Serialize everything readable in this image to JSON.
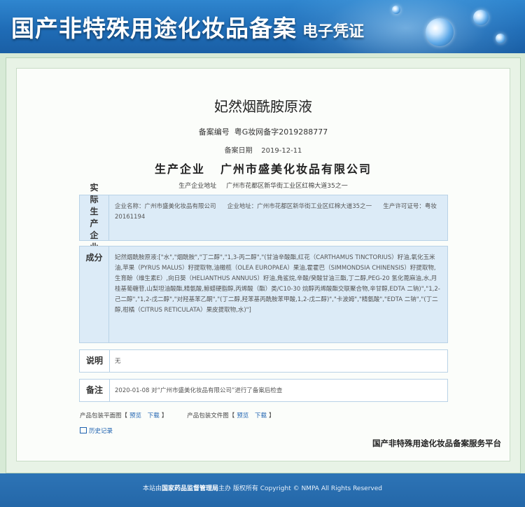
{
  "banner": {
    "title": "国产非特殊用途化妆品备案",
    "subtitle": "电子凭证"
  },
  "product": {
    "name": "妃然烟酰胺原液",
    "record_no_label": "备案编号",
    "record_no": "粤G妆网备字2019288777",
    "record_date_label": "备案日期",
    "record_date": "2019-12-11"
  },
  "producer": {
    "label": "生产企业",
    "name": "广州市盛美化妆品有限公司",
    "address_label": "生产企业地址",
    "address": "广州市花都区新华街工业区红棉大道35之一"
  },
  "sections": {
    "enterprise": {
      "label": "实际生产企业",
      "name_label": "企业名称：",
      "name": "广州市盛美化妆品有限公司",
      "address_label": "企业地址：",
      "address": "广州市花都区新华街工业区红棉大道35之一",
      "license_label": "生产许可证号：",
      "license": "粤妆20161194"
    },
    "ingredients": {
      "label": "成分",
      "text": "妃然烟酰胺原液:[\"水\",\"烟酰胺\",\"丁二醇\",\"1,3-丙二醇\",\"(甘油辛酸酯,红花（CARTHAMUS TINCTORIUS）籽油,氧化玉米油,苹果（PYRUS MALUS）籽提取物,油橄榄（OLEA EUROPAEA）果油,霍霍巴（SIMMONDSIA CHINENSIS）籽提取物,生育酚（维生素E）,向日葵（HELIANTHUS ANNUUS）籽油,角鲨烷,辛酸/癸酸甘油三酯,丁二醇,PEG-20 氢化蓖麻油,水,月桂基葡糖苷,山梨坦油酸酯,精氨酸,鲸蜡硬脂醇,丙烯酸（酯）类/C10-30 烷醇丙烯酸酯交联聚合物,辛甘醇,EDTA 二钠)\",\"1,2-己二醇\",\"1,2-戊二醇\",\"对羟基苯乙酮\",\"(丁二醇,羟苯基丙酰胺苯甲酸,1,2-戊二醇)\",\"卡波姆\",\"精氨酸\",\"EDTA 二钠\",\"(丁二醇,柑橘（CITRUS RETICULATA）果皮提取物,水)\"]"
    },
    "note": {
      "label": "说明",
      "text": "无"
    },
    "remark": {
      "label": "备注",
      "text": "2020-01-08 对“广州市盛美化妆品有限公司”进行了备案后检查"
    }
  },
  "links": {
    "package_flat_label": "产品包装平面图【",
    "package_text_label": "产品包装文件图【",
    "preview": "预览",
    "download": "下载",
    "close_bracket": "】",
    "history": "历史记录"
  },
  "platform_name": "国产非特殊用途化妆品备案服务平台",
  "footer": {
    "prefix": "本站由",
    "org": "国家药品监督管理局",
    "suffix": "主办 版权所有 Copyright © NMPA All Rights Reserved"
  }
}
